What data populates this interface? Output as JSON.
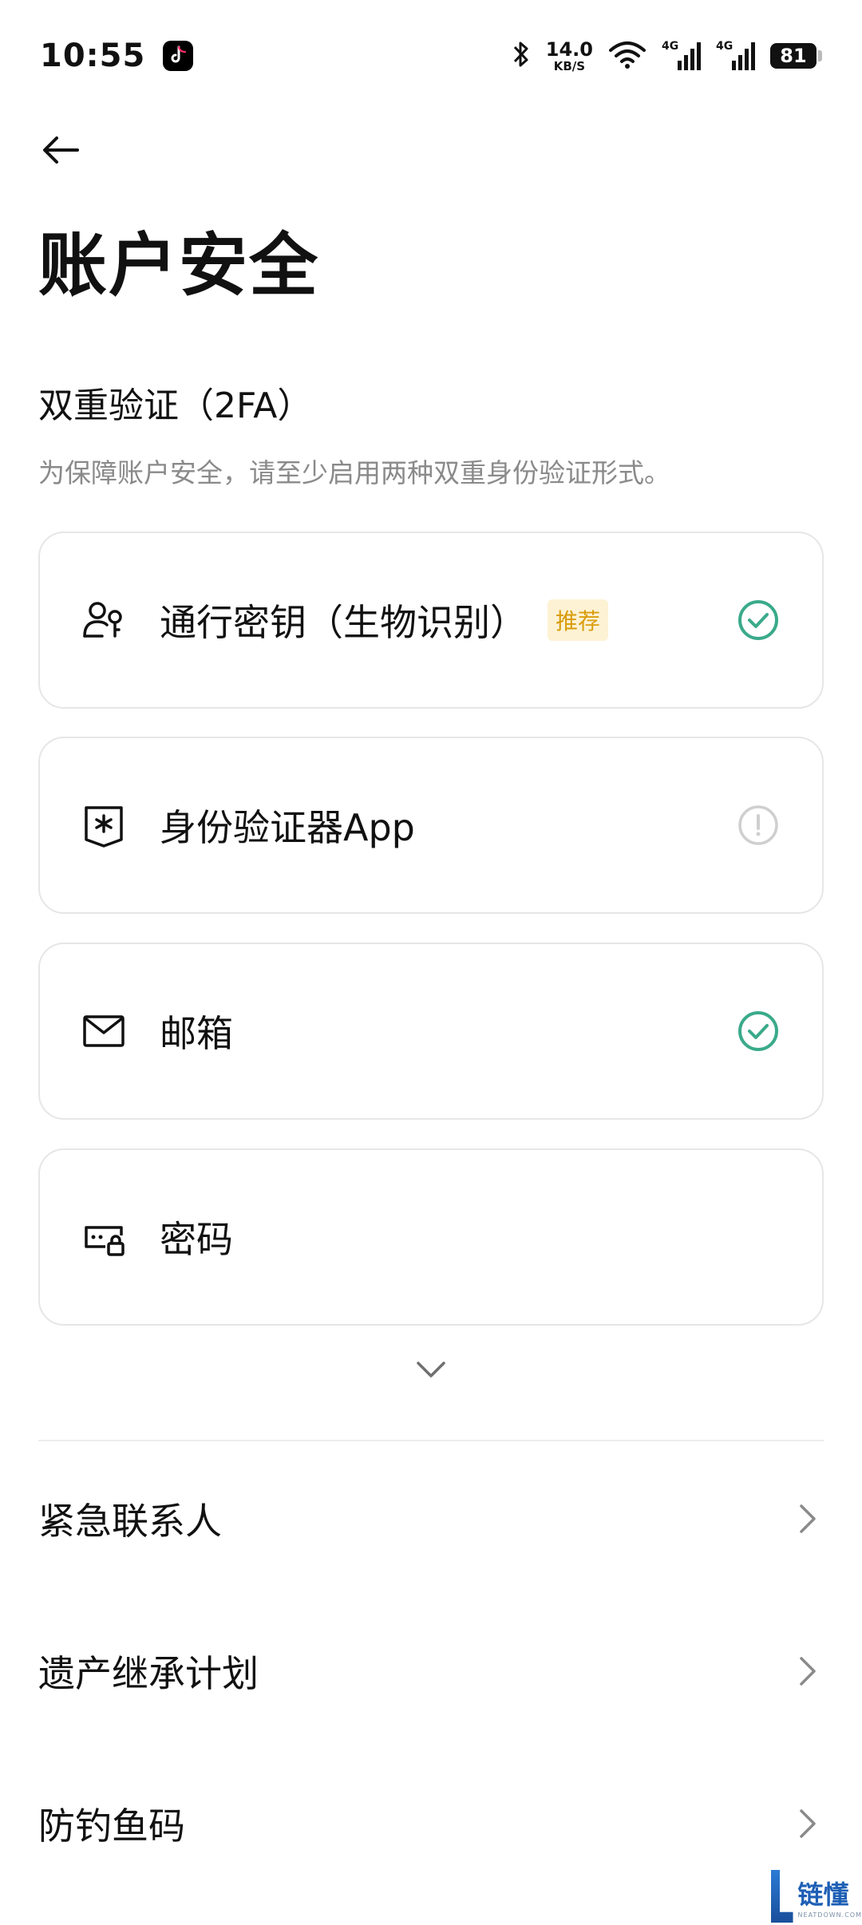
{
  "status_bar": {
    "time": "10:55",
    "net_speed_value": "14.0",
    "net_speed_unit": "KB/S",
    "signal_1_tag": "4G",
    "signal_2_tag": "4G",
    "battery": "81"
  },
  "header": {
    "title": "账户安全"
  },
  "two_factor": {
    "title": "双重验证（2FA）",
    "subtitle": "为保障账户安全，请至少启用两种双重身份验证形式。",
    "methods": [
      {
        "label": "通行密钥（生物识别）",
        "badge": "推荐",
        "icon": "passkey-icon",
        "status": "enabled"
      },
      {
        "label": "身份验证器App",
        "icon": "authenticator-icon",
        "status": "warning"
      },
      {
        "label": "邮箱",
        "icon": "mail-icon",
        "status": "enabled"
      },
      {
        "label": "密码",
        "icon": "password-icon",
        "status": "none"
      }
    ]
  },
  "settings": [
    {
      "label": "紧急联系人"
    },
    {
      "label": "遗产继承计划"
    },
    {
      "label": "防钓鱼码"
    }
  ],
  "watermark": {
    "text": "链懂",
    "subtext": "NEATDOWN.COM"
  },
  "colors": {
    "success": "#3aaa8a",
    "warning_muted": "#cfcfcf",
    "badge_bg": "#fdf2d4",
    "badge_fg": "#d99c0a"
  }
}
